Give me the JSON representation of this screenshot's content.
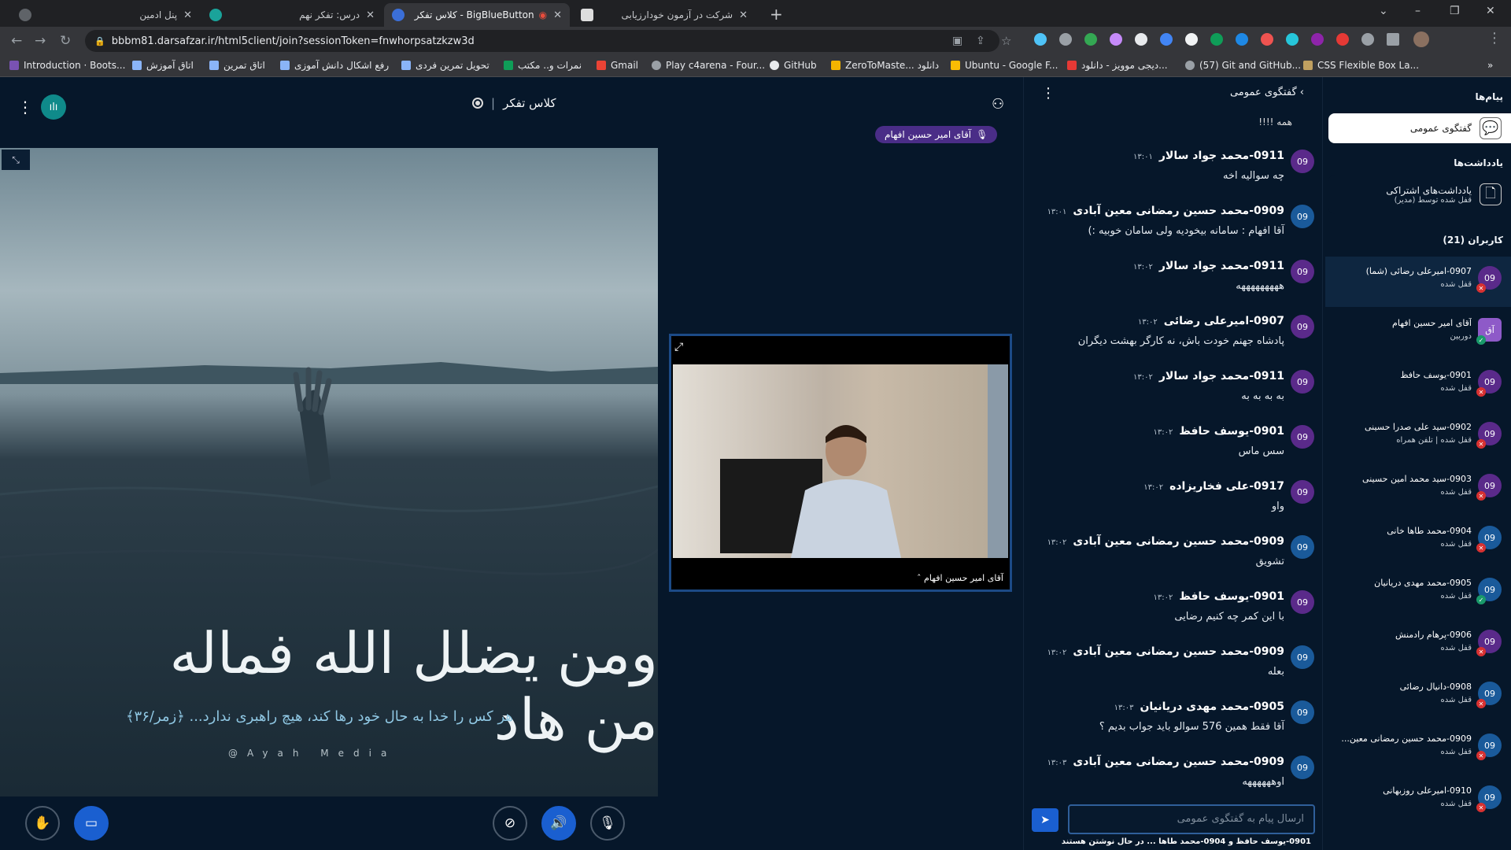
{
  "browser": {
    "tabs": [
      {
        "title": "پنل ادمین"
      },
      {
        "title": "درس: تفکر نهم"
      },
      {
        "title": "BigBlueButton - کلاس تفکر"
      },
      {
        "title": "شرکت در آزمون خودارزیابی"
      }
    ],
    "url": "bbbm81.darsafzar.ir/html5client/join?sessionToken=fnwhorpsatzkzw3d",
    "bookmarks": [
      "Introduction · Boots...",
      "اتاق آموزش",
      "اتاق تمرین",
      "رفع اشکال دانش آموزی",
      "تحویل تمرین فردی",
      "نمرات و.. مکتب",
      "Gmail",
      "Play c4arena - Four...",
      "GitHub",
      "ZeroToMaste... دانلود",
      "Ubuntu - Google F...",
      "دیجی موویز - دانلود...",
      "(57) Git and GitHub...",
      "CSS Flexible Box La..."
    ]
  },
  "header": {
    "room_title": "کلاس تفکر",
    "connection_badge": "ılı",
    "speaker": "آقای امیر حسین افهام"
  },
  "presentation": {
    "calligraphy": "ومن یضلل الله فماله من هاد",
    "verse": "هر کس را خدا به حال خود رها کند، هیچ راهبری ندارد...  ﴿زمر/۳۶﴾",
    "watermark": "@Ayah  Media"
  },
  "video": {
    "name": "آقای امیر حسین افهام"
  },
  "chat": {
    "title": "گفتگوی عمومی",
    "truncated_text": "همه !!!!",
    "messages": [
      {
        "avatar": "09",
        "avatar_color": "purple",
        "sender": "0911-محمد جواد سالار",
        "time": "۱۳:۰۱",
        "text": "چه سوالیه اخه"
      },
      {
        "avatar": "09",
        "avatar_color": "blue",
        "sender": "0909-محمد حسین رمضانی معین آبادی",
        "time": "۱۳:۰۱",
        "text": "آقا افهام : سامانه بیخودیه ولی سامان خوبیه :)"
      },
      {
        "avatar": "09",
        "avatar_color": "purple",
        "sender": "0911-محمد جواد سالار",
        "time": "۱۳:۰۲",
        "text": "هههههههههه"
      },
      {
        "avatar": "09",
        "avatar_color": "purple",
        "sender": "0907-امیرعلی رضائی",
        "time": "۱۳:۰۲",
        "text": "پادشاه جهنم خودت باش، نه کارگر بهشت دیگران"
      },
      {
        "avatar": "09",
        "avatar_color": "purple",
        "sender": "0911-محمد جواد سالار",
        "time": "۱۳:۰۲",
        "text": "به به به به"
      },
      {
        "avatar": "09",
        "avatar_color": "purple",
        "sender": "0901-یوسف حافظ",
        "time": "۱۳:۰۲",
        "text": "سس ماس"
      },
      {
        "avatar": "09",
        "avatar_color": "purple",
        "sender": "0917-علی فخاریزاده",
        "time": "۱۳:۰۲",
        "text": "واو"
      },
      {
        "avatar": "09",
        "avatar_color": "blue",
        "sender": "0909-محمد حسین رمضانی معین آبادی",
        "time": "۱۳:۰۲",
        "text": "تشویق"
      },
      {
        "avatar": "09",
        "avatar_color": "purple",
        "sender": "0901-یوسف حافظ",
        "time": "۱۳:۰۲",
        "text": "با این کمر چه کنیم رضایی"
      },
      {
        "avatar": "09",
        "avatar_color": "blue",
        "sender": "0909-محمد حسین رمضانی معین آبادی",
        "time": "۱۳:۰۲",
        "text": "بعله"
      },
      {
        "avatar": "09",
        "avatar_color": "blue",
        "sender": "0905-محمد مهدی دریانیان",
        "time": "۱۳:۰۳",
        "text": "آقا فقط همین 576 سوالو باید جواب بدیم ؟"
      },
      {
        "avatar": "09",
        "avatar_color": "blue",
        "sender": "0909-محمد حسین رمضانی معین آبادی",
        "time": "۱۳:۰۳",
        "text": "اوههههههه"
      }
    ],
    "input_placeholder": "ارسال پیام به گفتگوی عمومی",
    "typing": "0901-یوسف حافظ و 0904-محمد طاها ... در حال نوشتن هستند"
  },
  "sidebar": {
    "messages_title": "پیام‌ها",
    "public_chat_label": "گفتگوی عمومی",
    "notes_title": "یادداشت‌ها",
    "notes_label": "یادداشت‌های اشتراکی",
    "notes_sub": "قفل شده توسط (مدیر)",
    "users_title": "کاربران (21)",
    "users": [
      {
        "avatar": "09",
        "color": "purple",
        "name": "0907-امیرعلی رضائی (شما)",
        "sub": "قفل شده",
        "status": "lock",
        "you": true
      },
      {
        "avatar": "آق",
        "color": "purple",
        "name": "آقای امیر حسین افهام",
        "sub": "دوربین",
        "status": "ok",
        "you": false
      },
      {
        "avatar": "09",
        "color": "purple",
        "name": "0901-یوسف حافظ",
        "sub": "قفل شده",
        "status": "lock",
        "you": false
      },
      {
        "avatar": "09",
        "color": "purple",
        "name": "0902-سید علی صدرا حسینی",
        "sub": "قفل شده | تلفن همراه",
        "status": "lock",
        "you": false
      },
      {
        "avatar": "09",
        "color": "purple",
        "name": "0903-سید محمد امین حسینی",
        "sub": "قفل شده",
        "status": "lock",
        "you": false
      },
      {
        "avatar": "09",
        "color": "blue",
        "name": "0904-محمد طاها خانی",
        "sub": "قفل شده",
        "status": "lock",
        "you": false
      },
      {
        "avatar": "09",
        "color": "blue",
        "name": "0905-محمد مهدی دریانیان",
        "sub": "قفل شده",
        "status": "ok",
        "you": false
      },
      {
        "avatar": "09",
        "color": "purple",
        "name": "0906-پرهام رادمنش",
        "sub": "قفل شده",
        "status": "lock",
        "you": false
      },
      {
        "avatar": "09",
        "color": "blue",
        "name": "0908-دانیال رضائی",
        "sub": "قفل شده",
        "status": "lock",
        "you": false
      },
      {
        "avatar": "09",
        "color": "blue",
        "name": "0909-محمد حسین رمضانی معین...",
        "sub": "قفل شده",
        "status": "lock",
        "you": false
      },
      {
        "avatar": "09",
        "color": "blue",
        "name": "0910-امیرعلی روزبهانی",
        "sub": "قفل شده",
        "status": "lock",
        "you": false
      }
    ]
  },
  "controls": {
    "icons": [
      "raise-hand-icon",
      "presentation-icon",
      "camera-off-icon",
      "speaker-icon",
      "mic-off-icon"
    ]
  }
}
